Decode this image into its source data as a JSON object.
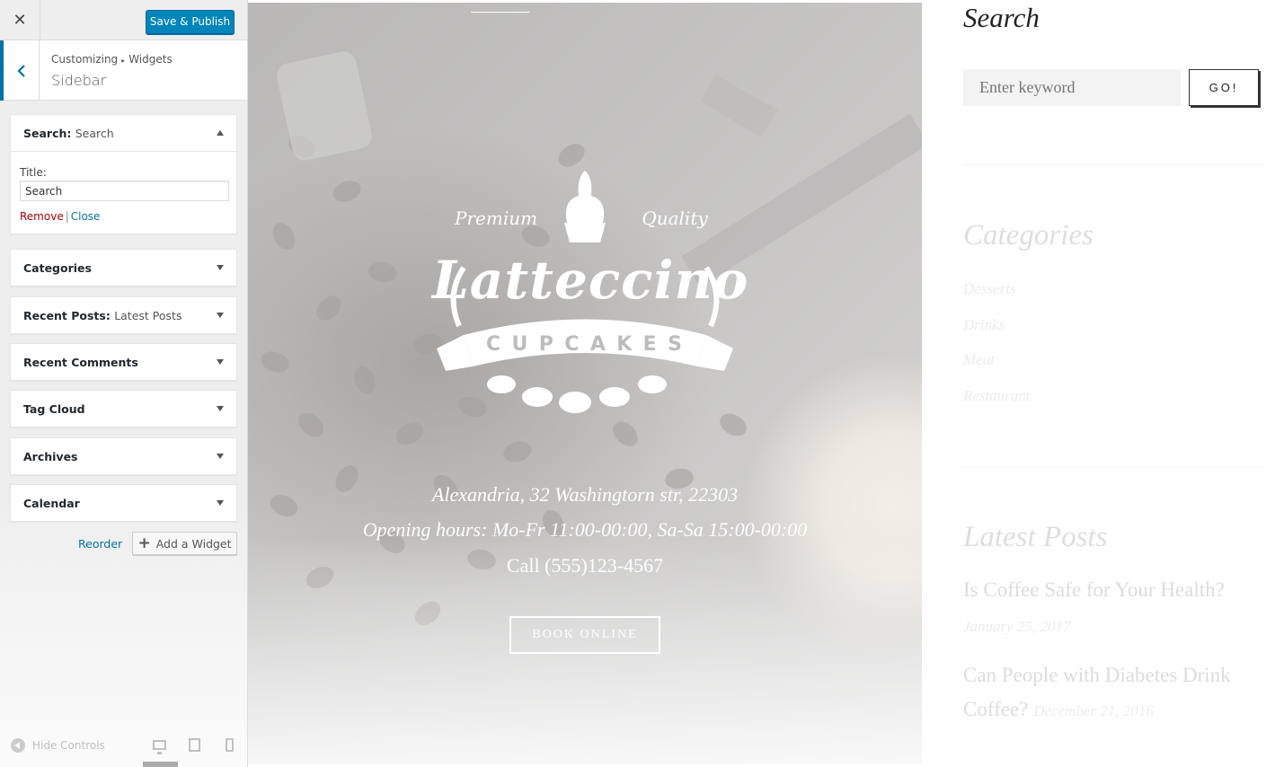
{
  "topbar": {
    "close_glyph": "✕",
    "publish_label": "Save & Publish"
  },
  "section": {
    "breadcrumb_root": "Customizing",
    "breadcrumb_sep": "▸",
    "breadcrumb_current": "Widgets",
    "title": "Sidebar"
  },
  "widgets": {
    "search": {
      "name": "Search",
      "instance": "Search",
      "title_label": "Title:",
      "title_value": "Search",
      "remove_label": "Remove",
      "close_label": "Close"
    },
    "items": [
      {
        "name": "Categories",
        "instance": ""
      },
      {
        "name": "Recent Posts",
        "instance": "Latest Posts"
      },
      {
        "name": "Recent Comments",
        "instance": ""
      },
      {
        "name": "Tag Cloud",
        "instance": ""
      },
      {
        "name": "Archives",
        "instance": ""
      },
      {
        "name": "Calendar",
        "instance": ""
      }
    ],
    "reorder_label": "Reorder",
    "add_label": "Add a Widget"
  },
  "footer": {
    "hide_controls_label": "Hide Controls"
  },
  "hero": {
    "premium_left": "Premium",
    "premium_right": "Quality",
    "brand": "Latteccino",
    "banner_letters": [
      "C",
      "U",
      "P",
      "C",
      "A",
      "K",
      "E",
      "S"
    ],
    "address": "Alexandria, 32 Washingtorn str, 22303",
    "hours": "Opening hours: Mo-Fr 11:00-00:00, Sa-Sa 15:00-00:00",
    "phone": "Call (555)123-4567",
    "book_label": "BOOK ONLINE"
  },
  "preview_sidebar": {
    "search_title": "Search",
    "search_placeholder": "Enter keyword",
    "go_label": "GO!",
    "categories_title": "Categories",
    "categories": [
      "Desserts",
      "Drinks",
      "Meat",
      "Restaurant"
    ],
    "latest_title": "Latest Posts",
    "posts": [
      {
        "title": "Is Coffee Safe for Your Health?",
        "date": "January 25, 2017"
      },
      {
        "title": "Can People with Diabetes Drink Coffee?",
        "date": "December 21, 2016"
      }
    ]
  },
  "colors": {
    "accent": "#0085ba",
    "link": "#0073aa",
    "remove": "#aa0000",
    "panel_bg": "#eeeeee"
  },
  "icons": [
    "close-icon",
    "back-chevron-icon",
    "caret-up-icon",
    "caret-down-icon",
    "plus-icon",
    "hide-controls-icon",
    "desktop-icon",
    "tablet-icon",
    "mobile-icon",
    "cupcake-icon"
  ]
}
